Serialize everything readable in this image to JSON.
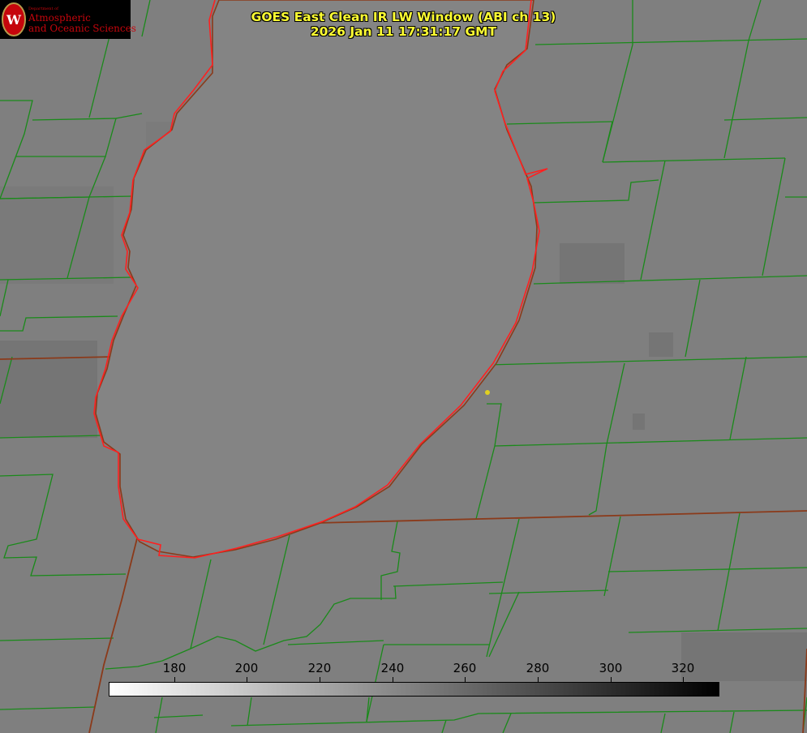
{
  "title": {
    "line1": "GOES East Clean IR LW Window (ABI ch 13)",
    "line2": "2026 Jan 11 17:31:17 GMT"
  },
  "logo": {
    "department": "Department of",
    "line1": "Atmospheric",
    "line2": "and Oceanic Sciences",
    "seal_letter": "W"
  },
  "colorbar": {
    "min": 162,
    "max": 330,
    "ticks": [
      "180",
      "200",
      "220",
      "240",
      "260",
      "280",
      "300",
      "320"
    ],
    "low_color": "#ffffff",
    "high_color": "#000000"
  },
  "map": {
    "background_gray": "#808080",
    "lake_gray": "#828282",
    "county_line_color": "#1a8a1a",
    "state_line_color": "#8b3a1a",
    "shoreline_color": "#ff2020",
    "marker_color": "#e0d020"
  }
}
